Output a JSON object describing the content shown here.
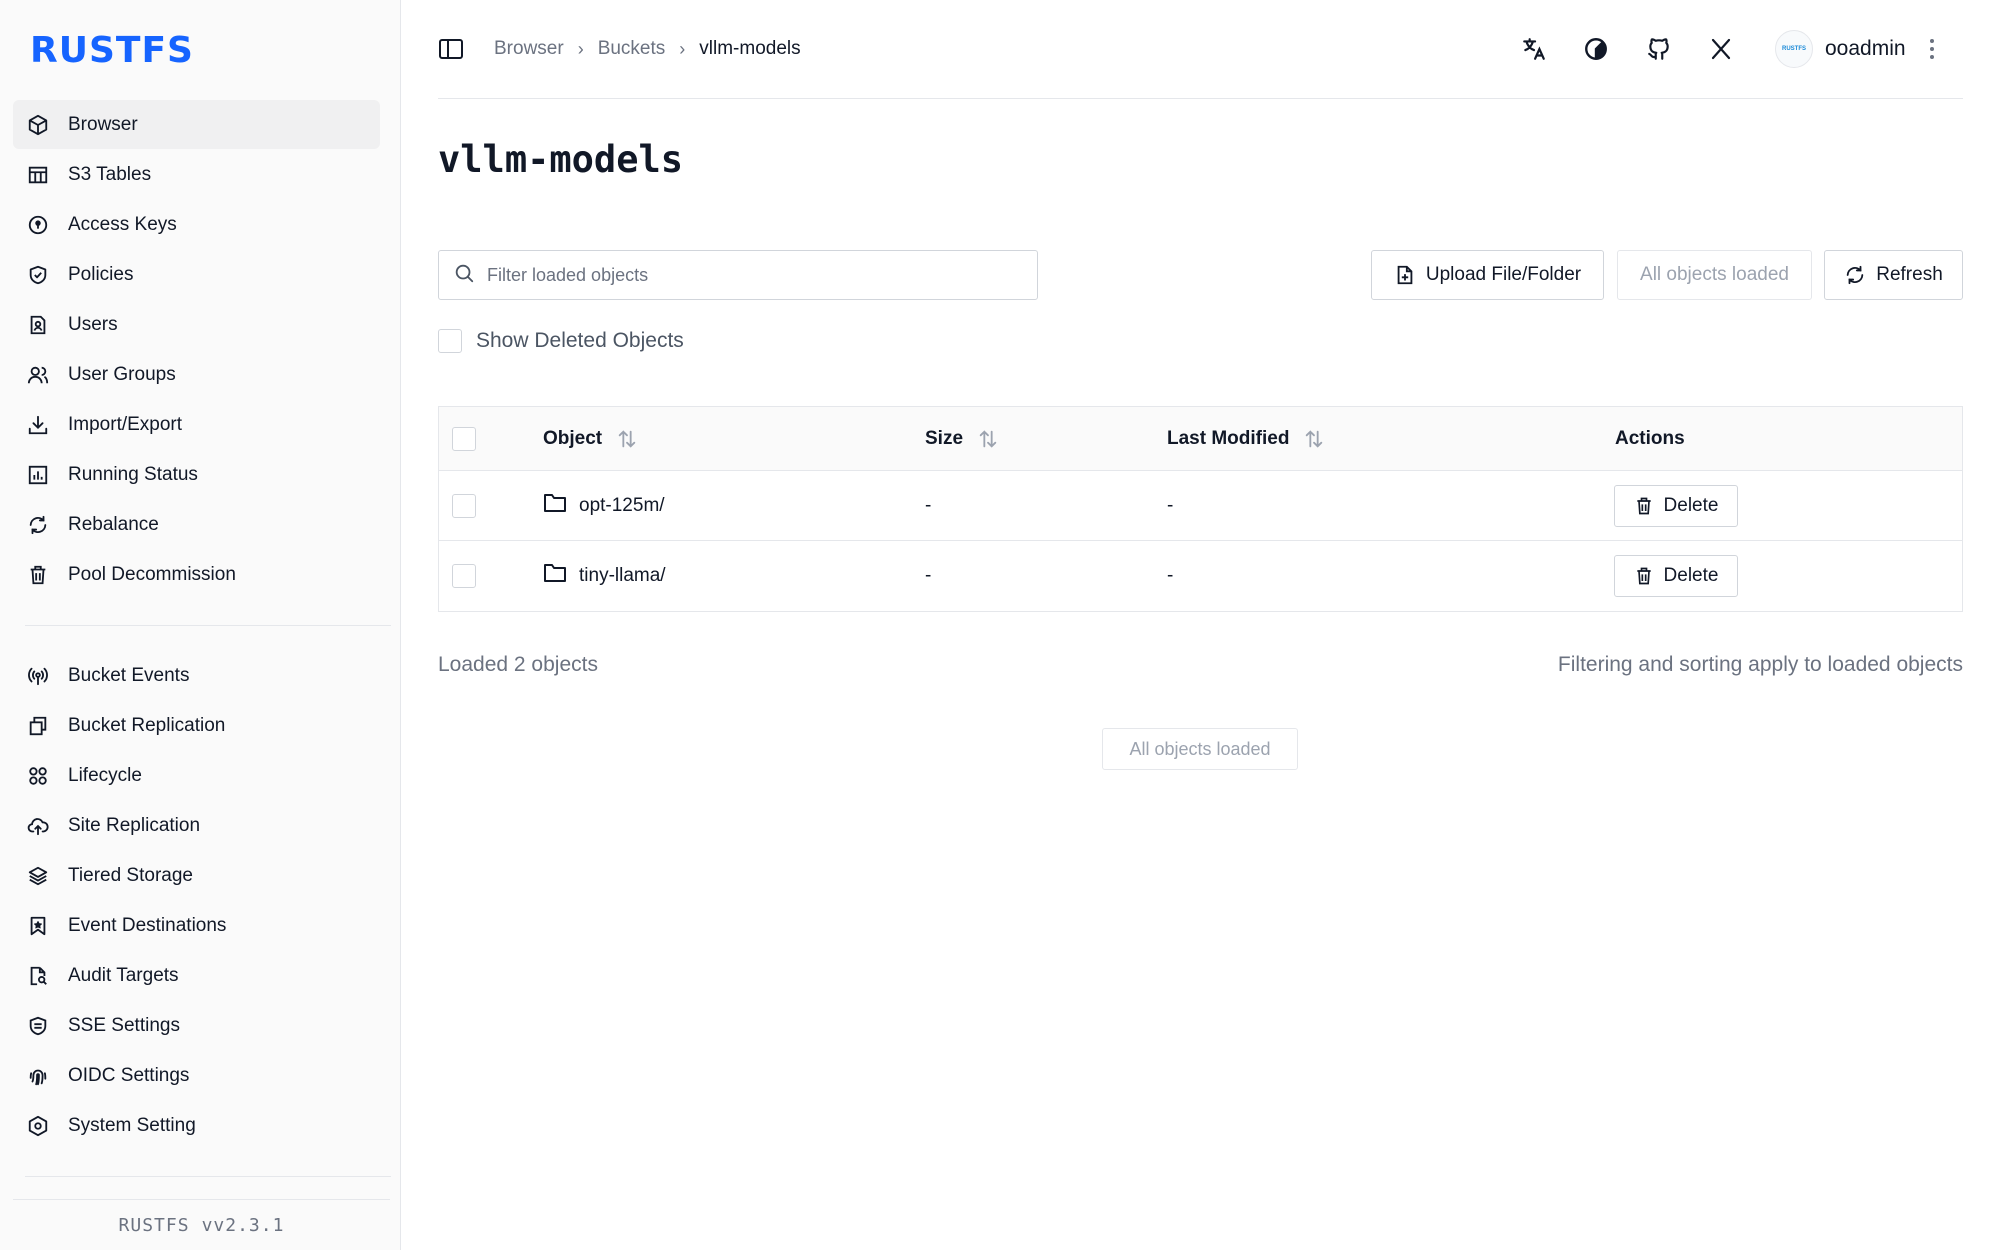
{
  "app": {
    "brand": "RUSTFS",
    "accent_color": "#1664ff"
  },
  "sidebar": {
    "primary": [
      {
        "label": "Browser",
        "icon": "cube-icon",
        "active": true
      },
      {
        "label": "S3 Tables",
        "icon": "table-icon"
      },
      {
        "label": "Access Keys",
        "icon": "key-circle-icon"
      },
      {
        "label": "Policies",
        "icon": "shield-check-icon"
      },
      {
        "label": "Users",
        "icon": "user-badge-icon"
      },
      {
        "label": "User Groups",
        "icon": "users-icon"
      },
      {
        "label": "Import/Export",
        "icon": "download-icon"
      },
      {
        "label": "Running Status",
        "icon": "bar-chart-icon"
      },
      {
        "label": "Rebalance",
        "icon": "refresh-icon"
      },
      {
        "label": "Pool Decommission",
        "icon": "trash-icon"
      }
    ],
    "secondary": [
      {
        "label": "Bucket Events",
        "icon": "broadcast-icon"
      },
      {
        "label": "Bucket Replication",
        "icon": "copy-icon"
      },
      {
        "label": "Lifecycle",
        "icon": "lifecycle-icon"
      },
      {
        "label": "Site Replication",
        "icon": "cloud-upload-icon"
      },
      {
        "label": "Tiered Storage",
        "icon": "layers-icon"
      },
      {
        "label": "Event Destinations",
        "icon": "bookmark-star-icon"
      },
      {
        "label": "Audit Targets",
        "icon": "file-search-icon"
      },
      {
        "label": "SSE Settings",
        "icon": "encryption-icon"
      },
      {
        "label": "OIDC Settings",
        "icon": "fingerprint-icon"
      },
      {
        "label": "System Setting",
        "icon": "settings-hex-icon"
      }
    ],
    "version_brand": "RUSTFS",
    "version": "vv2.3.1"
  },
  "header": {
    "breadcrumbs": [
      "Browser",
      "Buckets",
      "vllm-models"
    ],
    "icons": [
      "translate-icon",
      "theme-icon",
      "github-icon",
      "x-twitter-icon"
    ],
    "avatar_text": "RUSTFS",
    "username": "ooadmin"
  },
  "main": {
    "title": "vllm-models",
    "filter_placeholder": "Filter loaded objects",
    "upload_label": "Upload File/Folder",
    "all_loaded_label": "All objects loaded",
    "refresh_label": "Refresh",
    "show_deleted_label": "Show Deleted Objects",
    "table": {
      "columns": [
        "Object",
        "Size",
        "Last Modified",
        "Actions"
      ],
      "rows": [
        {
          "name": "opt-125m/",
          "size": "-",
          "modified": "-",
          "action": "Delete"
        },
        {
          "name": "tiny-llama/",
          "size": "-",
          "modified": "-",
          "action": "Delete"
        }
      ]
    },
    "loaded_text": "Loaded 2 objects",
    "filter_note": "Filtering and sorting apply to loaded objects",
    "all_loaded_footer": "All objects loaded"
  }
}
